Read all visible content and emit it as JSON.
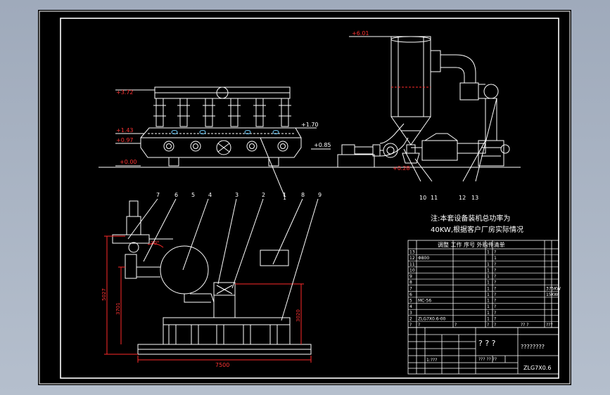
{
  "colors": {
    "background": "#000000",
    "line": "#ffffff",
    "dimension": "#ff2a2a",
    "viewport": "#a8b4c4"
  },
  "elevations": {
    "dryer": [
      "+3.72",
      "+1.43",
      "+0.97",
      "+0.00",
      "+1.70",
      "+0.85"
    ],
    "cyclone": [
      "+6.01",
      "+0.28"
    ]
  },
  "plan_dimensions": {
    "left_height": "5027",
    "mid_height": "3701",
    "right_height": "3020",
    "overall_width": "7500",
    "angle": "30°"
  },
  "balloons": {
    "top_callouts": [
      "1",
      "10",
      "11",
      "12",
      "13"
    ],
    "bottom_callouts": [
      "7",
      "6",
      "5",
      "4",
      "3",
      "2",
      "1",
      "8",
      "9"
    ]
  },
  "note": {
    "line1": "注:本套设备装机总功率为",
    "line2": "40KW,根据客户厂房实际情况"
  },
  "parts_table": {
    "header": "调整 工作 序号 外购件清单",
    "rows": [
      [
        "13",
        "",
        "",
        "1",
        "?",
        "",
        ""
      ],
      [
        "12",
        "Φ800",
        "",
        "",
        "1",
        "",
        ""
      ],
      [
        "11",
        "",
        "",
        "1",
        "?",
        "",
        ""
      ],
      [
        "10",
        "",
        "",
        "1",
        "?",
        "",
        ""
      ],
      [
        "9",
        "",
        "",
        "1",
        "?",
        "",
        ""
      ],
      [
        "8",
        "",
        "",
        "1",
        "?",
        "",
        ""
      ],
      [
        "7",
        "",
        "",
        "1",
        "?",
        "",
        "375KW"
      ],
      [
        "6",
        "",
        "",
        "1",
        "?",
        "",
        "15KW"
      ],
      [
        "5",
        "MC-56",
        "",
        "1",
        "?",
        "",
        ""
      ],
      [
        "4",
        "",
        "",
        "1",
        "?",
        "",
        ""
      ],
      [
        "3",
        "",
        "",
        "1",
        "?",
        "",
        ""
      ],
      [
        "2",
        "ZLG7X0.6-00",
        "",
        "1",
        "?",
        "",
        ""
      ],
      [
        "?",
        "?",
        "?",
        "?",
        "?",
        "?? ?",
        "???"
      ]
    ]
  },
  "title_block": {
    "code": "ZLG7X0.6",
    "center": "? ? ?",
    "name": "????????",
    "scale": "1:???",
    "sheet": "???  ??  ??"
  }
}
